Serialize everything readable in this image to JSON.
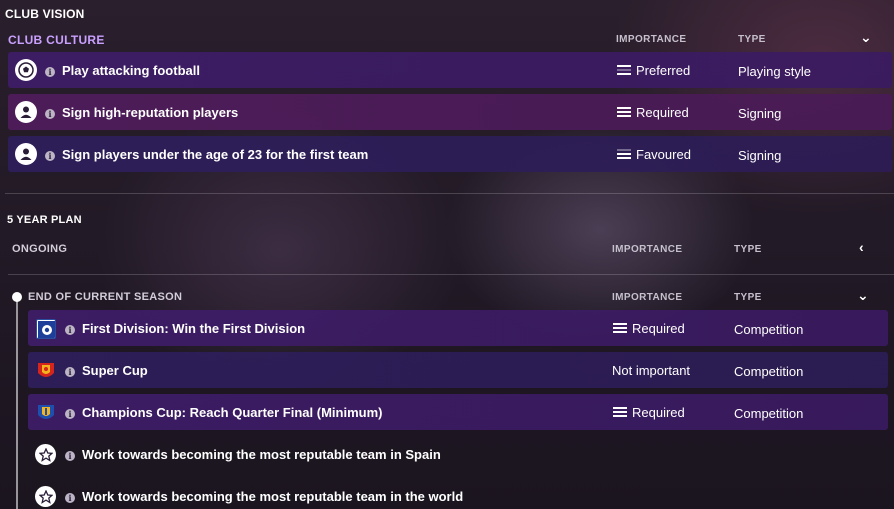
{
  "club_vision": {
    "title": "CLUB VISION",
    "culture": {
      "title": "CLUB CULTURE",
      "col_importance": "IMPORTANCE",
      "col_type": "TYPE",
      "rows": [
        {
          "icon": "football-icon",
          "label": "Play attacking football",
          "importance": "Preferred",
          "type": "Playing style"
        },
        {
          "icon": "person-icon",
          "label": "Sign high-reputation players",
          "importance": "Required",
          "type": "Signing"
        },
        {
          "icon": "person-icon",
          "label": "Sign players under the age of 23 for the first team",
          "importance": "Favoured",
          "type": "Signing"
        }
      ]
    }
  },
  "five_year_plan": {
    "title": "5 YEAR PLAN",
    "ongoing": {
      "title": "ONGOING",
      "col_importance": "IMPORTANCE",
      "col_type": "TYPE"
    },
    "end_of_season": {
      "title": "END OF CURRENT SEASON",
      "col_importance": "IMPORTANCE",
      "col_type": "TYPE",
      "rows": [
        {
          "icon": "first-division-icon",
          "label": "First Division: Win the First Division",
          "importance": "Required",
          "type": "Competition"
        },
        {
          "icon": "super-cup-icon",
          "label": "Super Cup",
          "importance": "Not important",
          "type": "Competition"
        },
        {
          "icon": "champions-cup-icon",
          "label": "Champions Cup: Reach Quarter Final (Minimum)",
          "importance": "Required",
          "type": "Competition"
        },
        {
          "icon": "star-icon",
          "label": "Work towards becoming the most reputable team in Spain",
          "importance": "",
          "type": ""
        },
        {
          "icon": "star-icon",
          "label": "Work towards becoming the most reputable team in the world",
          "importance": "",
          "type": ""
        }
      ]
    }
  },
  "colors": {
    "accent_purple_text": "#c9a0ff",
    "row_purple": "#3e1c68",
    "row_magenta": "#501c5c"
  }
}
